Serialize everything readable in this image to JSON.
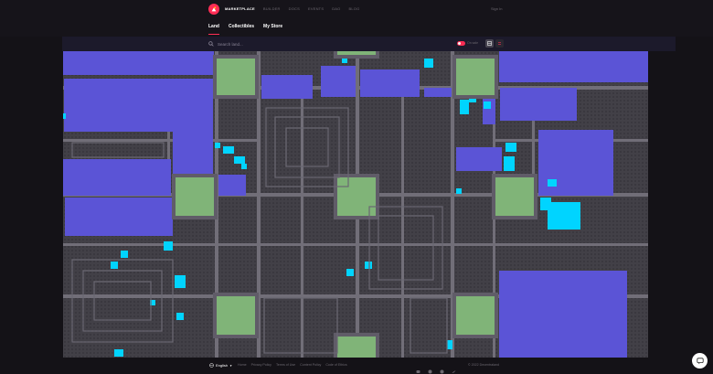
{
  "app": {
    "brand_color": "#ff2d55"
  },
  "topnav": {
    "items": [
      "MARKETPLACE",
      "BUILDER",
      "DOCS",
      "EVENTS",
      "DAO",
      "BLOG"
    ],
    "active_index": 0,
    "signin_label": "Sign In"
  },
  "subnav": {
    "tabs": [
      "Land",
      "Collectibles",
      "My Store"
    ],
    "active_index": 0
  },
  "search": {
    "placeholder": "Search land...",
    "toggle_label": "On sale"
  },
  "map": {
    "colors": {
      "background": "#3a383f",
      "road": "#716e78",
      "plaza": "#80b478",
      "plaza_border": "#605c68",
      "district": "#5b54d6",
      "owned": "#00d4ff",
      "parcel_outline": "#49474e"
    }
  },
  "footer": {
    "language": "English",
    "links": [
      "Home",
      "Privacy Policy",
      "Terms of Use",
      "Content Policy",
      "Code of Ethics"
    ],
    "social": [
      "discord-icon",
      "reddit-icon",
      "github-icon",
      "twitter-icon"
    ],
    "copyright": "© 2022 Decentraland"
  }
}
